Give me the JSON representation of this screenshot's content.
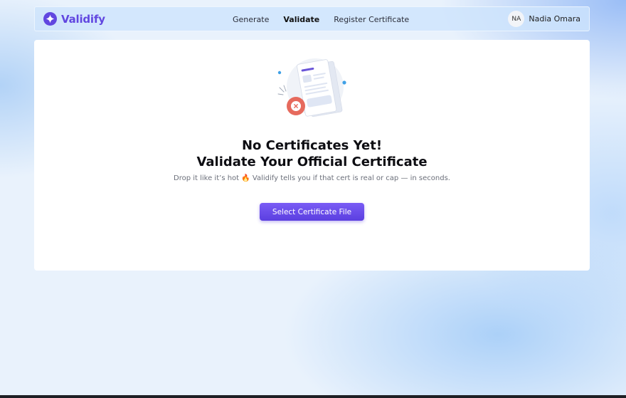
{
  "app": {
    "name": "Validify",
    "brand_color": "#6147e0"
  },
  "nav": {
    "links": [
      {
        "label": "Generate",
        "active": false
      },
      {
        "label": "Validate",
        "active": true
      },
      {
        "label": "Register Certificate",
        "active": false
      }
    ]
  },
  "user": {
    "initials": "NA",
    "name": "Nadia Omara"
  },
  "main": {
    "illustration_icon": "document-rejected-icon",
    "title_line1": "No Certificates Yet!",
    "title_line2": "Validate Your Official Certificate",
    "subtitle": "Drop it like it’s hot 🔥 Validify tells you if that cert is real or cap — in seconds.",
    "cta_label": "Select Certificate File",
    "cta_color": "#6a4df0"
  }
}
